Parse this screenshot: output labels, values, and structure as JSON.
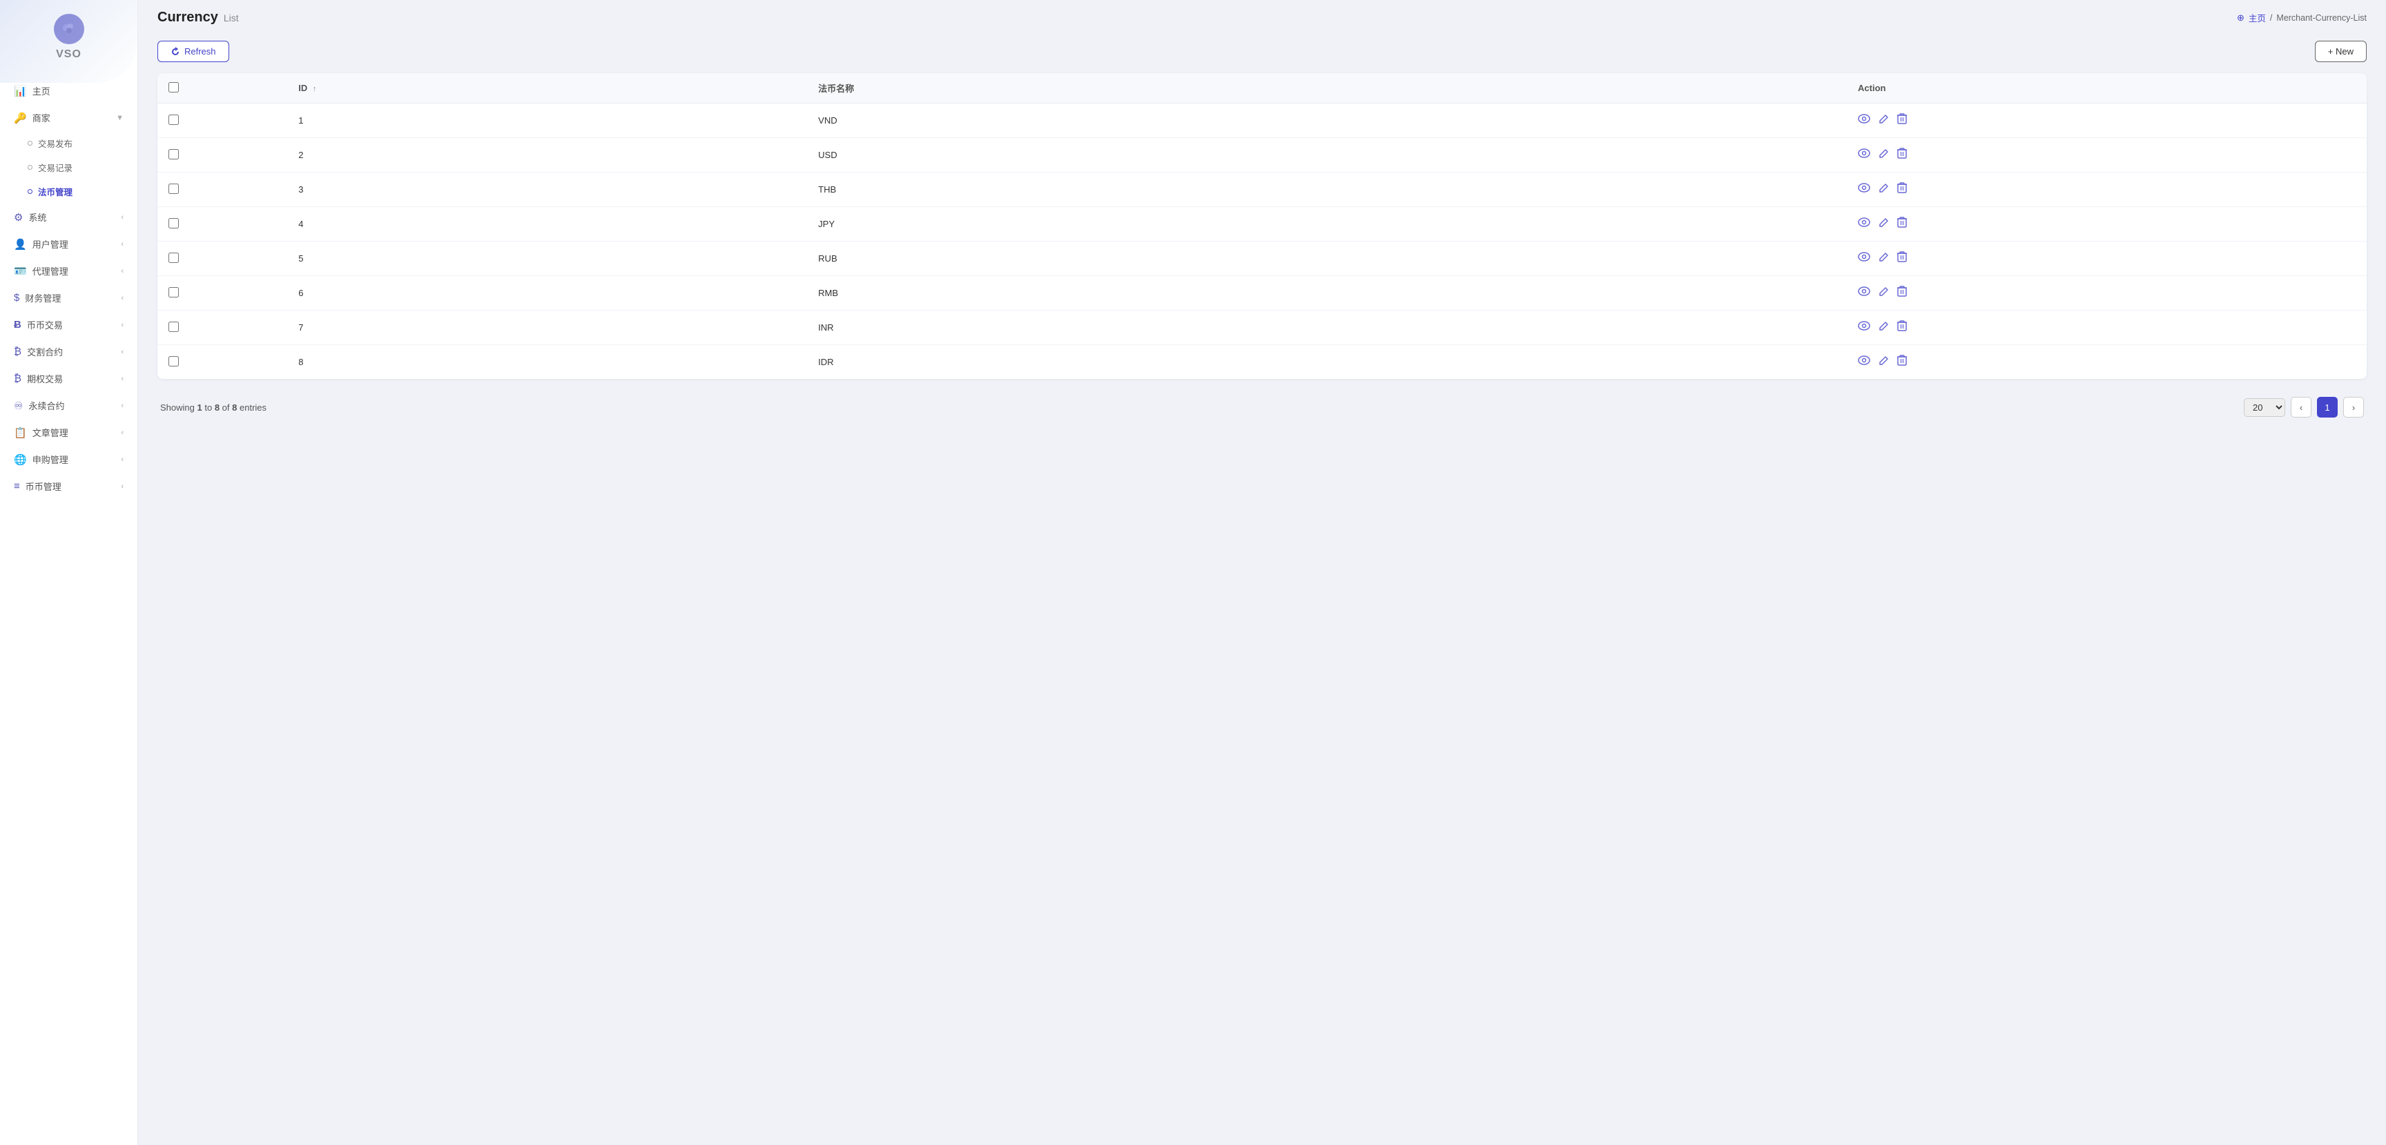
{
  "sidebar": {
    "brand": "VSO",
    "nav": [
      {
        "id": "home",
        "icon": "📊",
        "label": "主页",
        "hasChildren": false
      },
      {
        "id": "merchant",
        "icon": "🔑",
        "label": "商家",
        "hasChildren": true,
        "expanded": true,
        "children": [
          {
            "id": "trade-publish",
            "label": "交易发布",
            "active": false
          },
          {
            "id": "trade-record",
            "label": "交易记录",
            "active": false
          },
          {
            "id": "currency-manage",
            "label": "法币管理",
            "active": true
          }
        ]
      },
      {
        "id": "system",
        "icon": "⚙",
        "label": "系统",
        "hasChildren": true
      },
      {
        "id": "user-manage",
        "icon": "👤",
        "label": "用户管理",
        "hasChildren": true
      },
      {
        "id": "agent-manage",
        "icon": "🪪",
        "label": "代理管理",
        "hasChildren": true
      },
      {
        "id": "finance-manage",
        "icon": "$",
        "label": "财务管理",
        "hasChildren": true
      },
      {
        "id": "coin-trade",
        "icon": "Ƀ",
        "label": "币币交易",
        "hasChildren": true
      },
      {
        "id": "contract-split",
        "icon": "₿",
        "label": "交割合约",
        "hasChildren": true
      },
      {
        "id": "options-trade",
        "icon": "₿",
        "label": "期权交易",
        "hasChildren": true
      },
      {
        "id": "perpetual",
        "icon": "♾",
        "label": "永续合约",
        "hasChildren": true
      },
      {
        "id": "article-manage",
        "icon": "📋",
        "label": "文章管理",
        "hasChildren": true
      },
      {
        "id": "subscribe-manage",
        "icon": "🌐",
        "label": "申购管理",
        "hasChildren": true
      },
      {
        "id": "currency-manage2",
        "icon": "≡",
        "label": "币币管理",
        "hasChildren": true
      }
    ]
  },
  "header": {
    "title": "Currency",
    "subtitle": "List",
    "breadcrumb_home": "主页",
    "breadcrumb_current": "Merchant-Currency-List"
  },
  "toolbar": {
    "refresh_label": "Refresh",
    "new_label": "+ New"
  },
  "table": {
    "columns": [
      {
        "id": "check",
        "label": ""
      },
      {
        "id": "id",
        "label": "ID",
        "sortable": true
      },
      {
        "id": "name",
        "label": "法币名称"
      },
      {
        "id": "action",
        "label": "Action"
      }
    ],
    "rows": [
      {
        "id": 1,
        "name": "VND"
      },
      {
        "id": 2,
        "name": "USD"
      },
      {
        "id": 3,
        "name": "THB"
      },
      {
        "id": 4,
        "name": "JPY"
      },
      {
        "id": 5,
        "name": "RUB"
      },
      {
        "id": 6,
        "name": "RMB"
      },
      {
        "id": 7,
        "name": "INR"
      },
      {
        "id": 8,
        "name": "IDR"
      }
    ]
  },
  "footer": {
    "showing_prefix": "Showing ",
    "showing_from": "1",
    "showing_to": "8",
    "showing_total": "8",
    "showing_suffix": " entries",
    "page_size": "20",
    "current_page": 1
  }
}
